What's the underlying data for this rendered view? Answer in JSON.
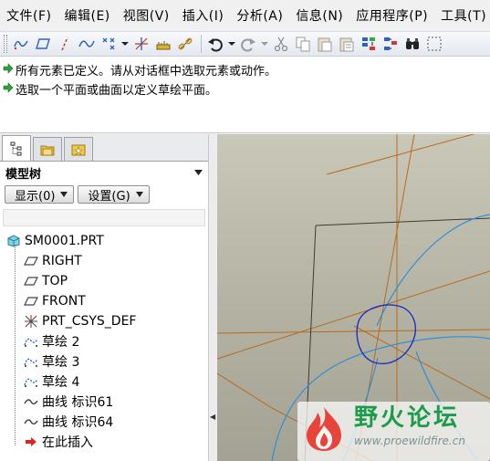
{
  "menu": [
    "文件(F)",
    "编辑(E)",
    "视图(V)",
    "插入(I)",
    "分析(A)",
    "信息(N)",
    "应用程序(P)",
    "工具(T)"
  ],
  "toolbar": {
    "icons": [
      "grip",
      "sketch-datum-icon",
      "plane-icon",
      "axis-icon",
      "curve-icon",
      "point-icon",
      "csys-icon",
      "analysis-icon",
      "link-icon",
      "undo-icon",
      "redo-icon",
      "cut-icon",
      "copy-icon",
      "paste-icon",
      "paste-special-icon",
      "regenerate-icon",
      "regen-manager-icon",
      "find-icon",
      "select-box-icon"
    ]
  },
  "messages": [
    "所有元素已定义。请从对话框中选取元素或动作。",
    "选取一个平面或曲面以定义草绘平面。"
  ],
  "left_panel": {
    "title": "模型树",
    "display_button": "显示(0)",
    "settings_button": "设置(G)",
    "tree": [
      {
        "label": "SM0001.PRT",
        "icon": "part-icon",
        "level": 0
      },
      {
        "label": "RIGHT",
        "icon": "datum-plane-icon",
        "level": 1
      },
      {
        "label": "TOP",
        "icon": "datum-plane-icon",
        "level": 1
      },
      {
        "label": "FRONT",
        "icon": "datum-plane-icon",
        "level": 1
      },
      {
        "label": "PRT_CSYS_DEF",
        "icon": "csys-icon",
        "level": 1
      },
      {
        "label": "草绘 2",
        "icon": "sketch-icon",
        "level": 1
      },
      {
        "label": "草绘 3",
        "icon": "sketch-icon",
        "level": 1
      },
      {
        "label": "草绘 4",
        "icon": "sketch-icon",
        "level": 1
      },
      {
        "label": "曲线 标识61",
        "icon": "curve-icon",
        "level": 1
      },
      {
        "label": "曲线 标识64",
        "icon": "curve-icon",
        "level": 1
      },
      {
        "label": "在此插入",
        "icon": "insert-arrow-icon",
        "level": 1
      }
    ]
  },
  "watermark": {
    "title": "野火论坛",
    "url": "www.proewildfire.cn"
  },
  "colors": {
    "graphics_bg": "#bebdad",
    "datum_orange": "#b96a1e",
    "curve_blue": "#2e8fd8",
    "curve_dark_blue": "#1e2fc8",
    "watermark_green": "#1c9c4a"
  }
}
